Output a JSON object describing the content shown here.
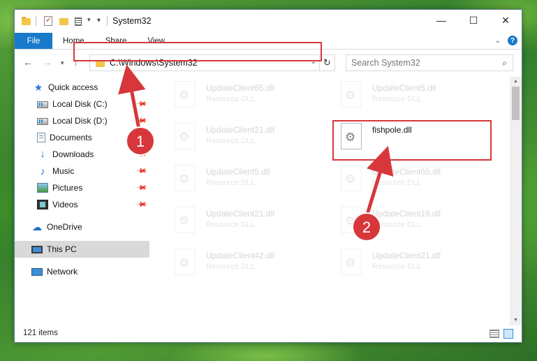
{
  "window": {
    "title": "System32",
    "controls": {
      "minimize": "—",
      "maximize": "☐",
      "close": "✕"
    }
  },
  "ribbon": {
    "tabs": [
      "File",
      "Home",
      "Share",
      "View"
    ],
    "collapse_icon": "chevron-down-icon",
    "help_label": "?"
  },
  "navigation": {
    "back": "←",
    "forward": "→",
    "up": "↑",
    "recent": "▾"
  },
  "address": {
    "path": "C:\\Windows\\System32",
    "refresh": "↻",
    "dropdown": "⌄"
  },
  "search": {
    "placeholder": "Search System32"
  },
  "sidebar": {
    "items": [
      {
        "label": "Quick access",
        "icon": "star-icon",
        "pinned": false
      },
      {
        "label": "Local Disk (C:)",
        "icon": "drive-icon",
        "pinned": true
      },
      {
        "label": "Local Disk (D:)",
        "icon": "drive-icon",
        "pinned": true
      },
      {
        "label": "Documents",
        "icon": "documents-icon",
        "pinned": true
      },
      {
        "label": "Downloads",
        "icon": "download-icon",
        "pinned": true
      },
      {
        "label": "Music",
        "icon": "music-icon",
        "pinned": true
      },
      {
        "label": "Pictures",
        "icon": "pictures-icon",
        "pinned": true
      },
      {
        "label": "Videos",
        "icon": "videos-icon",
        "pinned": true
      },
      {
        "label": "OneDrive",
        "icon": "cloud-icon",
        "pinned": false
      },
      {
        "label": "This PC",
        "icon": "pc-icon",
        "pinned": false,
        "selected": true
      },
      {
        "label": "Network",
        "icon": "network-icon",
        "pinned": false
      }
    ]
  },
  "files": {
    "left_column": [
      {
        "name": "UpdateClient65.dll",
        "type": "Resource DLL"
      },
      {
        "name": "UpdateClient21.dll",
        "type": "Resource DLL"
      },
      {
        "name": "UpdateClient5.dll",
        "type": "Resource DLL"
      },
      {
        "name": "UpdateClient21.dll",
        "type": "Resource DLL"
      },
      {
        "name": "UpdateClient42.dll",
        "type": "Resource DLL"
      }
    ],
    "right_column": [
      {
        "name": "UpdateClient5.dll",
        "type": "Resource DLL"
      },
      {
        "name": "fishpole.dll",
        "type": "",
        "highlighted": true
      },
      {
        "name": "UpdateClient65.dll",
        "type": "Resource DLL"
      },
      {
        "name": "UpdateClient19.dll",
        "type": "Resource DLL"
      },
      {
        "name": "UpdateClient21.dll",
        "type": "Resource DLL"
      }
    ]
  },
  "status": {
    "item_count": "121 items"
  },
  "annotations": {
    "step1": "1",
    "step2": "2",
    "accent_color": "#d7373b"
  }
}
